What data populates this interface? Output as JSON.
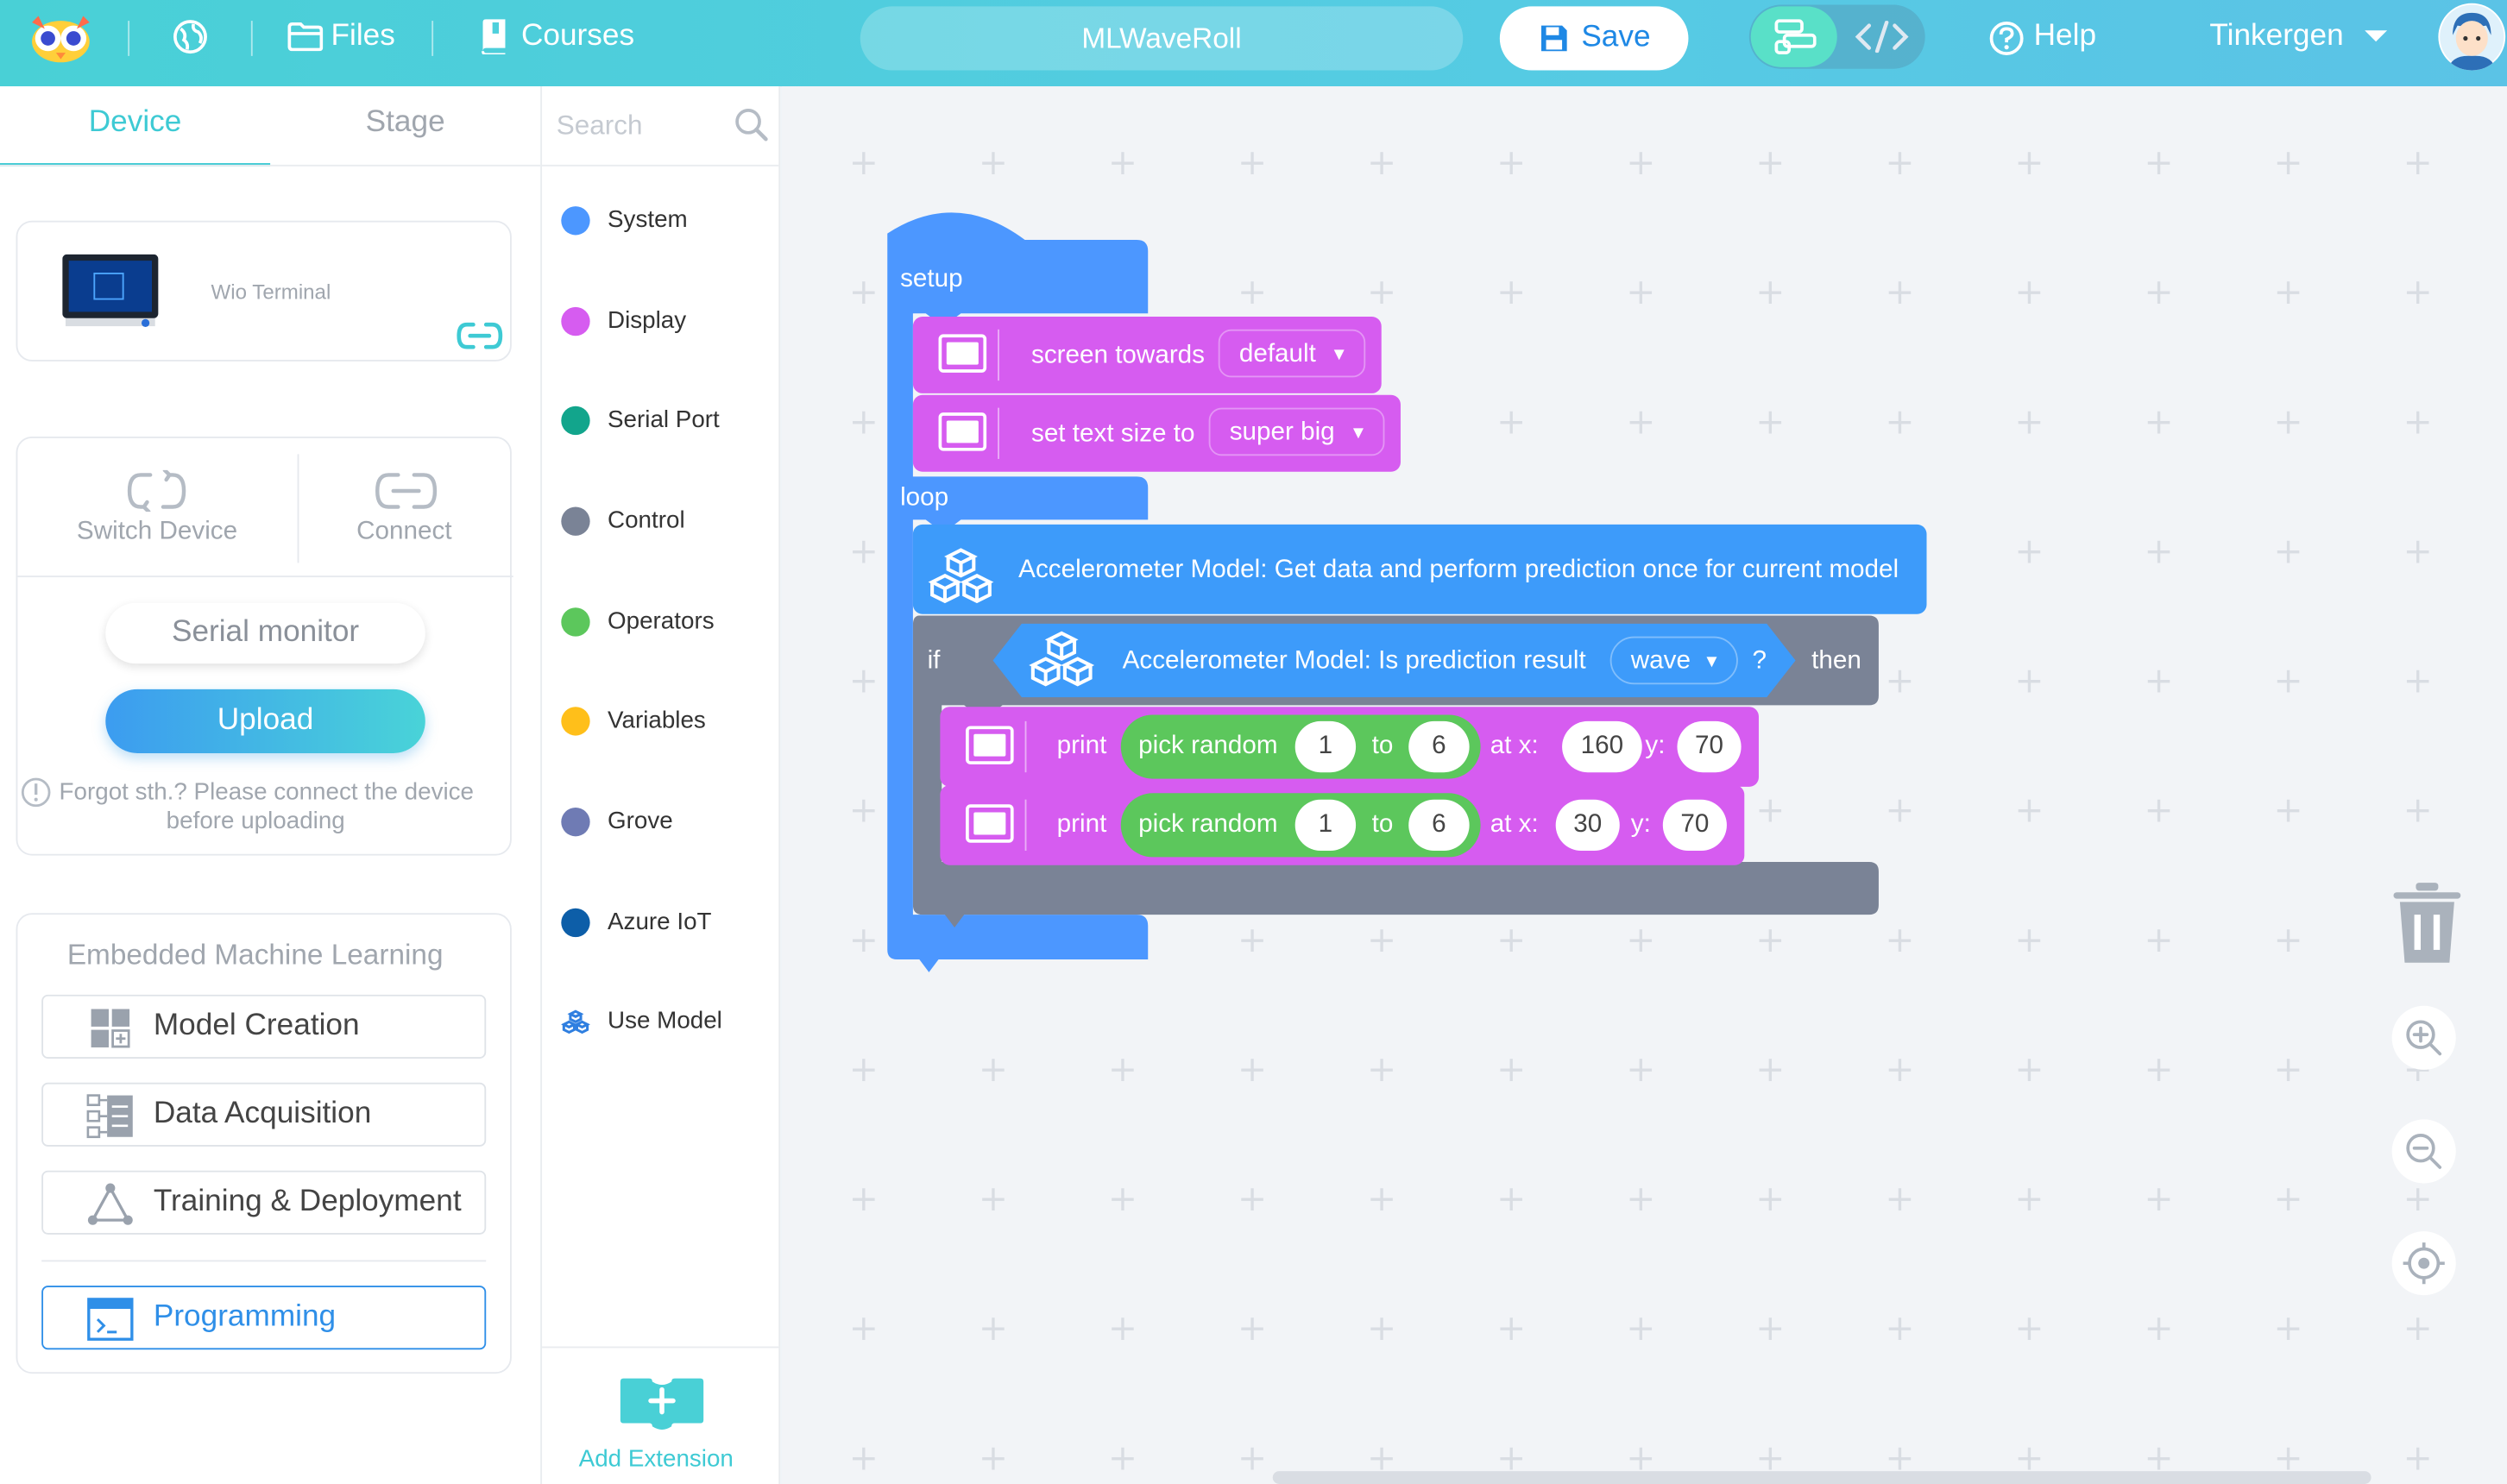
{
  "header": {
    "files_label": "Files",
    "courses_label": "Courses",
    "project_name": "MLWaveRoll",
    "save_label": "Save",
    "help_label": "Help",
    "user_name": "Tinkergen",
    "accent_color": "#4fd0dc"
  },
  "left_panel": {
    "tabs": [
      "Device",
      "Stage"
    ],
    "device_name": "Wio Terminal",
    "switch_device_label": "Switch Device",
    "connect_label": "Connect",
    "serial_monitor_label": "Serial monitor",
    "upload_label": "Upload",
    "warning_line1": "Forgot sth.? Please connect the device",
    "warning_line2": "before uploading",
    "ml_title": "Embedded Machine Learning",
    "ml_items": [
      "Model Creation",
      "Data Acquisition",
      "Training & Deployment",
      "Programming"
    ]
  },
  "categories": {
    "search_placeholder": "Search",
    "items": [
      {
        "label": "System",
        "color": "#4c97ff"
      },
      {
        "label": "Display",
        "color": "#d65cf0"
      },
      {
        "label": "Serial Port",
        "color": "#12a58c"
      },
      {
        "label": "Control",
        "color": "#7a8396"
      },
      {
        "label": "Operators",
        "color": "#5cc75c"
      },
      {
        "label": "Variables",
        "color": "#ffbf1a"
      },
      {
        "label": "Grove",
        "color": "#6f7bb4"
      },
      {
        "label": "Azure IoT",
        "color": "#0d5ea8"
      },
      {
        "label": "Use Model",
        "color": "#2f7fe0"
      }
    ],
    "add_extension_label": "Add Extension"
  },
  "blocks": {
    "setup_label": "setup",
    "screen_towards": "screen towards",
    "screen_towards_value": "default",
    "set_text_size": "set text size to",
    "set_text_size_value": "super big",
    "loop_label": "loop",
    "accel_get": "Accelerometer Model: Get data and perform prediction once for current model",
    "if_label": "if",
    "accel_is": "Accelerometer Model: Is prediction result",
    "accel_is_value": "wave",
    "question": "?",
    "then_label": "then",
    "print1": {
      "print": "print",
      "pick": "pick random",
      "from": "1",
      "to_word": "to",
      "to": "6",
      "atx": "at x:",
      "x": "160",
      "y_word": "y:",
      "y": "70"
    },
    "print2": {
      "print": "print",
      "pick": "pick random",
      "from": "1",
      "to_word": "to",
      "to": "6",
      "atx": "at x:",
      "x": "30",
      "y_word": "y:",
      "y": "70"
    },
    "colors": {
      "event": "#4c97ff",
      "display": "#d65cf0",
      "model": "#3d9bfa",
      "control": "#7a8396",
      "operator": "#5cc75c"
    }
  }
}
